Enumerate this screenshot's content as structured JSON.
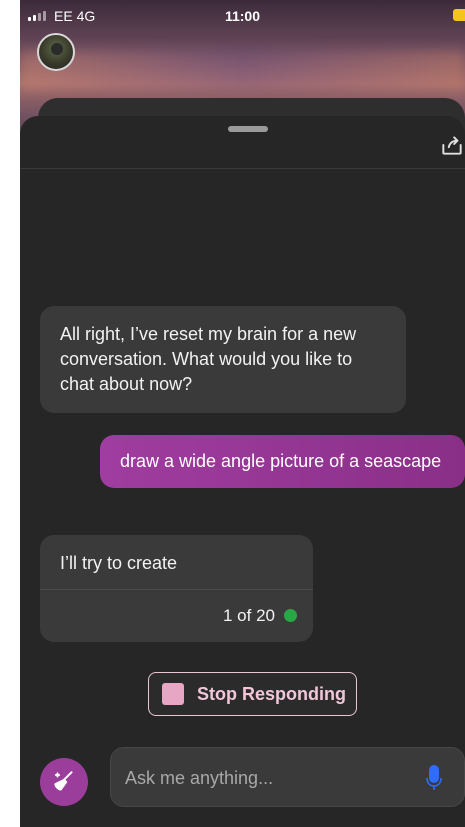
{
  "status_bar": {
    "carrier": "EE",
    "network": "4G",
    "time": "11:00"
  },
  "chat": {
    "messages": [
      {
        "role": "assistant",
        "text": "All right, I’ve reset my brain for a new conversation. What would you like to chat about now?"
      },
      {
        "role": "user",
        "text": "draw a wide angle picture of a seascape"
      },
      {
        "role": "assistant",
        "text": "I’ll try to create",
        "counter": "1 of 20"
      }
    ]
  },
  "controls": {
    "stop_label": "Stop Responding",
    "input_placeholder": "Ask me anything..."
  },
  "colors": {
    "accent": "#9b3e9b",
    "user_bubble": "#a03da0",
    "status_dot": "#27a845",
    "mic": "#2f6bff"
  },
  "icons": [
    "signal-icon",
    "battery-icon",
    "share-icon",
    "broom-icon",
    "microphone-icon",
    "stop-square-icon"
  ]
}
